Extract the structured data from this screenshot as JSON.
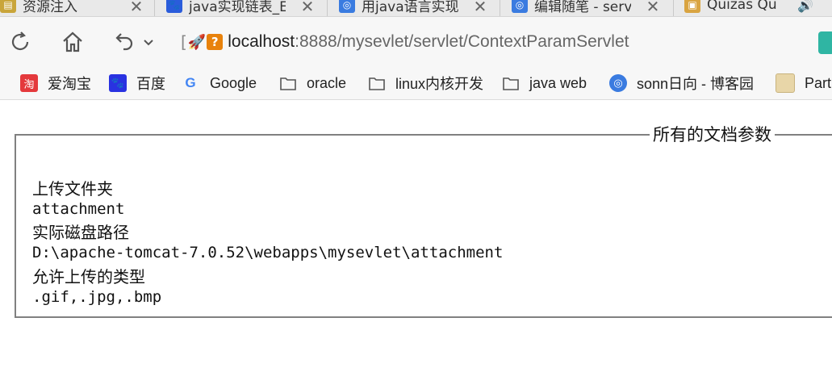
{
  "tabs": [
    {
      "title": "资源注入",
      "color": "#c9a53a",
      "active": false
    },
    {
      "title": "java实现链表_E",
      "color": "#2a5cdb",
      "active": false
    },
    {
      "title": "用java语言实现",
      "color": "#3a7be0",
      "active": false
    },
    {
      "title": "编辑随笔 - serv",
      "color": "#3a7be0",
      "active": false
    },
    {
      "title": "Quizas Qu",
      "color": "#d9a441",
      "active": true
    }
  ],
  "address": {
    "host": "localhost",
    "path": ":8888/mysevlet/servlet/ContextParamServlet"
  },
  "bookmarks": [
    {
      "label": "爱淘宝",
      "icon": "taobao-icon",
      "color": "#e4393c",
      "glyph": "淘"
    },
    {
      "label": "百度",
      "icon": "baidu-paw-icon",
      "color": "#2932e1",
      "glyph": "🐾"
    },
    {
      "label": "Google",
      "icon": "google-g-icon",
      "color": "#ffffff",
      "glyph": "G"
    },
    {
      "label": "oracle",
      "icon": "folder-icon",
      "color": "#ffffff",
      "glyph": ""
    },
    {
      "label": "linux内核开发",
      "icon": "folder-icon",
      "color": "#ffffff",
      "glyph": ""
    },
    {
      "label": "java web",
      "icon": "folder-icon",
      "color": "#ffffff",
      "glyph": ""
    },
    {
      "label": "sonn日向 - 博客园",
      "icon": "cnblogs-icon",
      "color": "#3a7be0",
      "glyph": "◎"
    },
    {
      "label": "Part",
      "icon": "folder-icon",
      "color": "#e8d6a8",
      "glyph": ""
    }
  ],
  "fieldset": {
    "legend": "所有的文档参数",
    "params": [
      {
        "name": "上传文件夹",
        "value": "attachment"
      },
      {
        "name": "实际磁盘路径",
        "value": "D:\\apache-tomcat-7.0.52\\webapps\\mysevlet\\attachment"
      },
      {
        "name": "允许上传的类型",
        "value": ".gif,.jpg,.bmp"
      }
    ]
  }
}
